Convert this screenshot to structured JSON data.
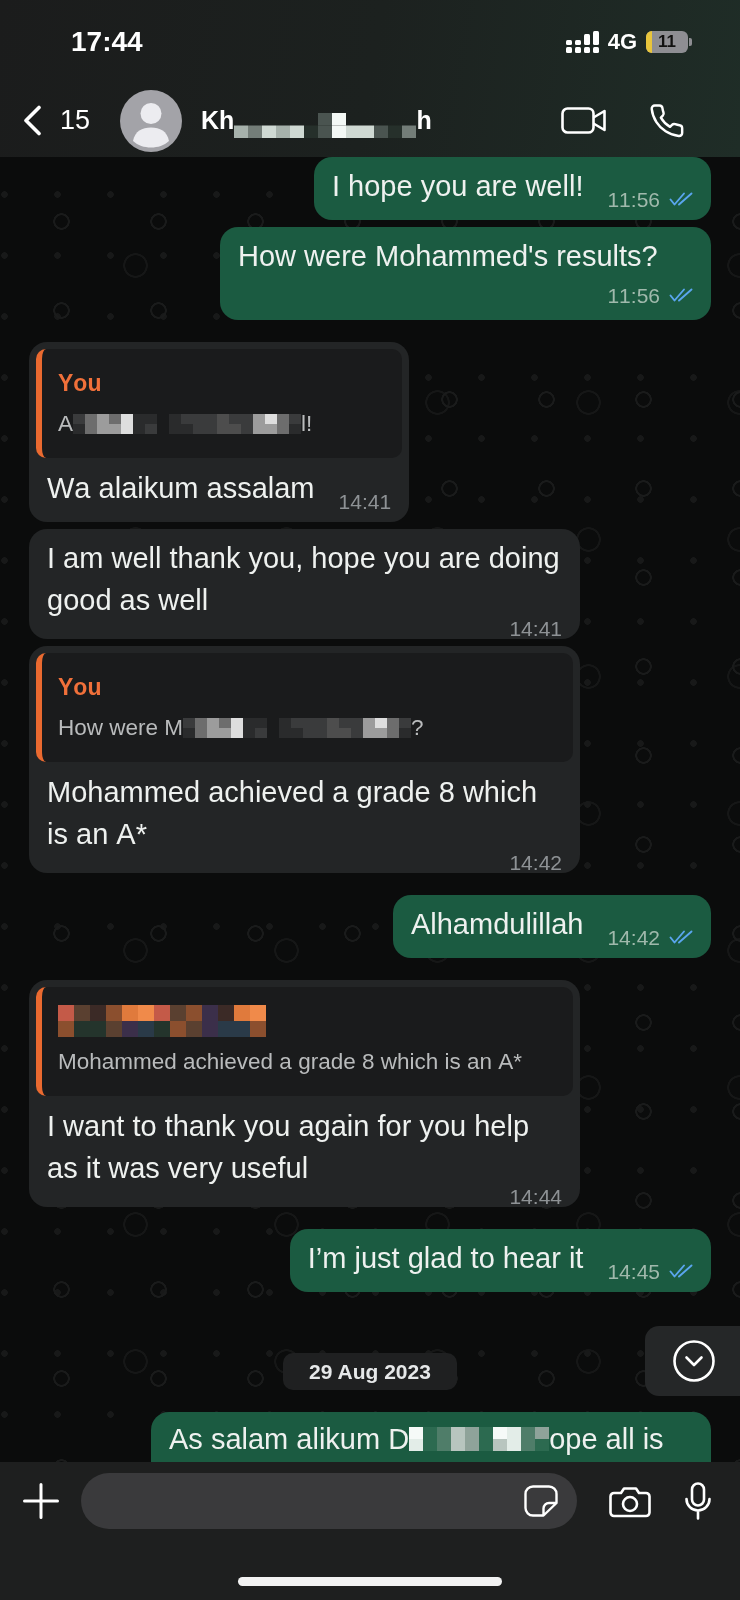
{
  "status_bar": {
    "time": "17:44",
    "network": "4G",
    "battery": "11"
  },
  "header": {
    "back_count": "15",
    "name_parts": [
      "Kh",
      "h"
    ]
  },
  "messages": [
    {
      "kind": "text",
      "outgoing": true,
      "text": "I hope you are well!",
      "time": "11:56",
      "read": true
    },
    {
      "kind": "text",
      "outgoing": true,
      "text": "How were Mohammed's results?",
      "time": "11:56",
      "read": true
    },
    {
      "kind": "reply",
      "outgoing": false,
      "quote": {
        "author": "You",
        "text_parts": [
          "A",
          "l!"
        ]
      },
      "text": "Wa alaikum assalam",
      "time": "14:41"
    },
    {
      "kind": "text",
      "outgoing": false,
      "text": "I am well thank you, hope you are doing good as well",
      "time": "14:41"
    },
    {
      "kind": "reply",
      "outgoing": false,
      "quote": {
        "author": "You",
        "text_parts": [
          "How were M",
          "?"
        ]
      },
      "text": "Mohammed achieved a grade 8 which is an A*",
      "time": "14:42"
    },
    {
      "kind": "text",
      "outgoing": true,
      "text": "Alhamdulillah",
      "time": "14:42",
      "read": true
    },
    {
      "kind": "reply",
      "outgoing": false,
      "quote": {
        "author_redacted": true,
        "text_parts": [
          "Mohammed achieved a grade 8 which is an A*"
        ]
      },
      "text": "I want to thank you again for you help as it was very useful",
      "time": "14:44"
    },
    {
      "kind": "text",
      "outgoing": true,
      "text": "I’m just glad to hear it",
      "time": "14:45",
      "read": true
    },
    {
      "kind": "date",
      "text": "29 Aug 2023"
    },
    {
      "kind": "partial",
      "outgoing": true,
      "text_parts": [
        "As salam alikum D",
        "ope all is"
      ]
    }
  ]
}
